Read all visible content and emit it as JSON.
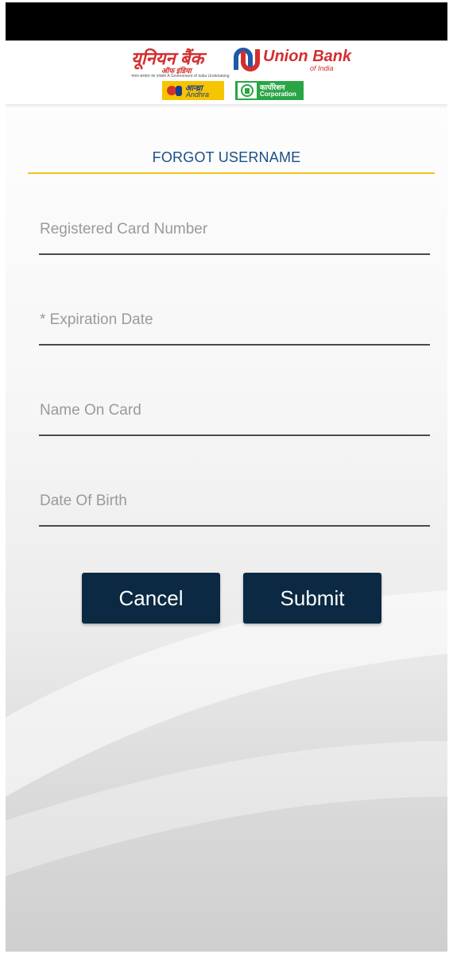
{
  "header": {
    "brand_hindi": "यूनियन बैंक",
    "brand_hindi_sub": "ऑफ इंडिया",
    "brand_english": "Union Bank",
    "brand_english_sub": "of India",
    "tagline": "भारत सरकार का उपक्रम  A Government of India Undertaking",
    "andhra_hindi": "आन्ध्रा",
    "andhra_english": "Andhra",
    "corporation_hindi": "कार्पोरेशन",
    "corporation_english": "Corporation"
  },
  "page": {
    "title": "FORGOT USERNAME"
  },
  "form": {
    "card_number": {
      "placeholder": "Registered Card Number",
      "value": ""
    },
    "expiration_date": {
      "placeholder": "* Expiration Date",
      "value": ""
    },
    "name_on_card": {
      "placeholder": "Name On Card",
      "value": ""
    },
    "date_of_birth": {
      "placeholder": "Date Of Birth",
      "value": ""
    }
  },
  "buttons": {
    "cancel_label": "Cancel",
    "submit_label": "Submit"
  },
  "colors": {
    "brand_red": "#d32f2f",
    "title_blue": "#1b4f86",
    "accent_yellow": "#f0c419",
    "button_navy": "#0b2942"
  }
}
